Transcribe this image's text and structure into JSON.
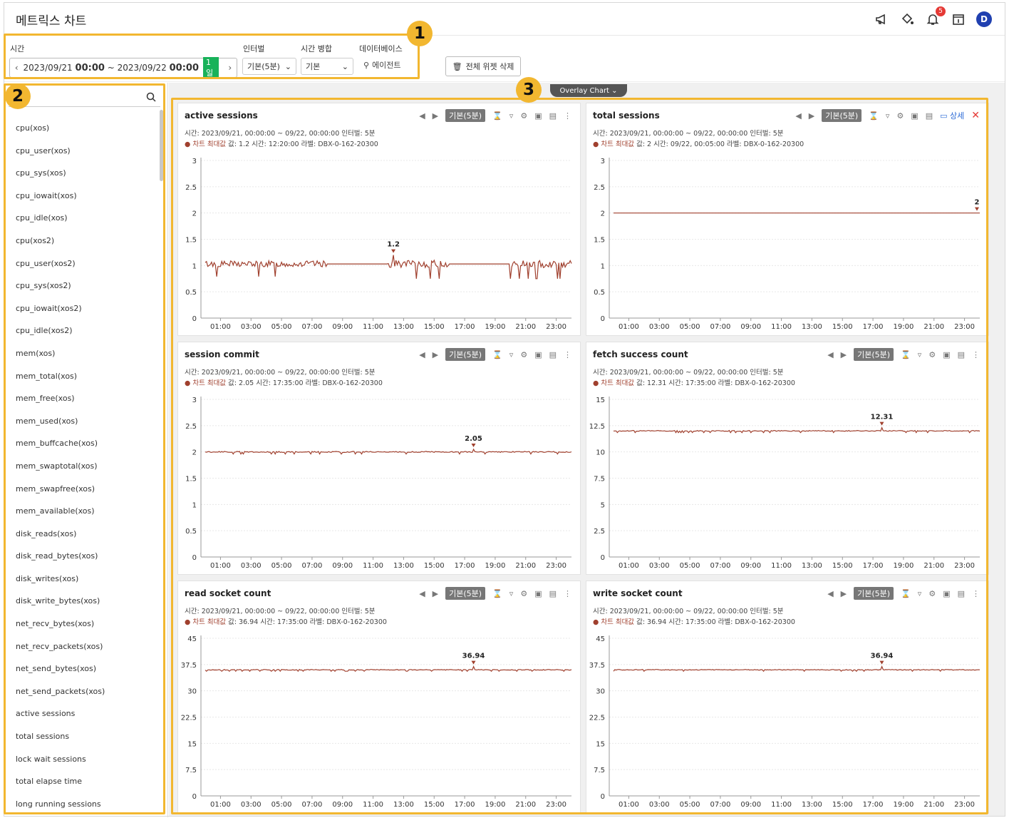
{
  "header": {
    "title": "메트릭스 차트",
    "notif_count": "5",
    "avatar": "D"
  },
  "toolbar": {
    "time_label": "시간",
    "range_start": "2023/09/21",
    "range_start_time": "00:00",
    "range_sep": "~",
    "range_end": "2023/09/22",
    "range_end_time": "00:00",
    "range_badge": "1일",
    "interval_label": "인터벌",
    "interval_value": "기본(5분)",
    "merge_label": "시간 병합",
    "merge_value": "기본",
    "db_label": "데이터베이스",
    "agent_label": "에이전트",
    "delete_all": "전체 위젯 삭제"
  },
  "callouts": [
    "1",
    "2",
    "3"
  ],
  "sidebar": {
    "items": [
      "cpu(xos)",
      "cpu_user(xos)",
      "cpu_sys(xos)",
      "cpu_iowait(xos)",
      "cpu_idle(xos)",
      "cpu(xos2)",
      "cpu_user(xos2)",
      "cpu_sys(xos2)",
      "cpu_iowait(xos2)",
      "cpu_idle(xos2)",
      "mem(xos)",
      "mem_total(xos)",
      "mem_free(xos)",
      "mem_used(xos)",
      "mem_buffcache(xos)",
      "mem_swaptotal(xos)",
      "mem_swapfree(xos)",
      "mem_available(xos)",
      "disk_reads(xos)",
      "disk_read_bytes(xos)",
      "disk_writes(xos)",
      "disk_write_bytes(xos)",
      "net_recv_bytes(xos)",
      "net_recv_packets(xos)",
      "net_send_bytes(xos)",
      "net_send_packets(xos)",
      "active sessions",
      "total sessions",
      "lock wait sessions",
      "total elapse time",
      "long running sessions"
    ]
  },
  "overlay_label": "Overlay Chart",
  "colors": {
    "accent": "#f2b730",
    "series": "#a0402e",
    "badge": "#19b25a"
  },
  "chart_data": [
    {
      "type": "line",
      "title": "active sessions",
      "chip": "기본(5분)",
      "meta": "시간: 2023/09/21, 00:00:00 ~ 09/22, 00:00:00  인터벌: 5분",
      "max_label": "차트 최대값",
      "max_text": "값: 1.2  시간: 12:20:00  라벨: DBX-0-162-20300",
      "yticks": [
        "0",
        "0.5",
        "1",
        "1.5",
        "2",
        "2.5",
        "3"
      ],
      "ylim": [
        0,
        3
      ],
      "xticks": [
        "01:00",
        "03:00",
        "05:00",
        "07:00",
        "09:00",
        "11:00",
        "13:00",
        "15:00",
        "17:00",
        "19:00",
        "21:00",
        "23:00"
      ],
      "base": 1.03,
      "noise": [
        0.06,
        0.06,
        0.0,
        0.07,
        0.0,
        0.07
      ],
      "peak": {
        "x": 12.33,
        "value": 1.2,
        "label": "1.2"
      }
    },
    {
      "type": "line",
      "title": "total sessions",
      "chip": "기본(5분)",
      "meta": "시간: 2023/09/21, 00:00:00 ~ 09/22, 00:00:00  인터벌: 5분",
      "max_label": "차트 최대값",
      "max_text": "값: 2  시간: 09/22, 00:05:00  라벨: DBX-0-162-20300",
      "yticks": [
        "0",
        "0.5",
        "1",
        "1.5",
        "2",
        "2.5",
        "3"
      ],
      "ylim": [
        0,
        3
      ],
      "xticks": [
        "01:00",
        "03:00",
        "05:00",
        "07:00",
        "09:00",
        "11:00",
        "13:00",
        "15:00",
        "17:00",
        "19:00",
        "21:00",
        "23:00"
      ],
      "base": 2,
      "noise": [
        0,
        0,
        0,
        0,
        0,
        0
      ],
      "peak": {
        "x": 24,
        "value": 2,
        "label": "2"
      },
      "detail": "상세"
    },
    {
      "type": "line",
      "title": "session commit",
      "chip": "기본(5분)",
      "meta": "시간: 2023/09/21, 00:00:00 ~ 09/22, 00:00:00  인터벌: 5분",
      "max_label": "차트 최대값",
      "max_text": "값: 2.05  시간: 17:35:00  라벨: DBX-0-162-20300",
      "yticks": [
        "0",
        "0.5",
        "1",
        "1.5",
        "2",
        "2.5",
        "3"
      ],
      "ylim": [
        0,
        3
      ],
      "xticks": [
        "01:00",
        "03:00",
        "05:00",
        "07:00",
        "09:00",
        "11:00",
        "13:00",
        "15:00",
        "17:00",
        "19:00",
        "21:00",
        "23:00"
      ],
      "base": 2,
      "noise": [
        0.01,
        0.01,
        0.01,
        0.01,
        0.01,
        0.01
      ],
      "peak": {
        "x": 17.58,
        "value": 2.05,
        "label": "2.05"
      }
    },
    {
      "type": "line",
      "title": "fetch success count",
      "chip": "기본(5분)",
      "meta": "시간: 2023/09/21, 00:00:00 ~ 09/22, 00:00:00  인터벌: 5분",
      "max_label": "차트 최대값",
      "max_text": "값: 12.31  시간: 17:35:00  라벨: DBX-0-162-20300",
      "yticks": [
        "0",
        "2.5",
        "5",
        "7.5",
        "10",
        "12.5",
        "15"
      ],
      "ylim": [
        0,
        15
      ],
      "xticks": [
        "01:00",
        "03:00",
        "05:00",
        "07:00",
        "09:00",
        "11:00",
        "13:00",
        "15:00",
        "17:00",
        "19:00",
        "21:00",
        "23:00"
      ],
      "base": 12,
      "noise": [
        0.04,
        0.04,
        0.04,
        0.04,
        0.04,
        0.04
      ],
      "peak": {
        "x": 17.58,
        "value": 12.31,
        "label": "12.31"
      }
    },
    {
      "type": "line",
      "title": "read socket count",
      "chip": "기본(5분)",
      "meta": "시간: 2023/09/21, 00:00:00 ~ 09/22, 00:00:00  인터벌: 5분",
      "max_label": "차트 최대값",
      "max_text": "값: 36.94  시간: 17:35:00  라벨: DBX-0-162-20300",
      "yticks": [
        "0",
        "7.5",
        "15",
        "22.5",
        "30",
        "37.5",
        "45"
      ],
      "ylim": [
        0,
        45
      ],
      "xticks": [
        "01:00",
        "03:00",
        "05:00",
        "07:00",
        "09:00",
        "11:00",
        "13:00",
        "15:00",
        "17:00",
        "19:00",
        "21:00",
        "23:00"
      ],
      "base": 36,
      "noise": [
        0.1,
        0.1,
        0.1,
        0.1,
        0.1,
        0.1
      ],
      "peak": {
        "x": 17.58,
        "value": 36.94,
        "label": "36.94"
      }
    },
    {
      "type": "line",
      "title": "write socket count",
      "chip": "기본(5분)",
      "meta": "시간: 2023/09/21, 00:00:00 ~ 09/22, 00:00:00  인터벌: 5분",
      "max_label": "차트 최대값",
      "max_text": "값: 36.94  시간: 17:35:00  라벨: DBX-0-162-20300",
      "yticks": [
        "0",
        "7.5",
        "15",
        "22.5",
        "30",
        "37.5",
        "45"
      ],
      "ylim": [
        0,
        45
      ],
      "xticks": [
        "01:00",
        "03:00",
        "05:00",
        "07:00",
        "09:00",
        "11:00",
        "13:00",
        "15:00",
        "17:00",
        "19:00",
        "21:00",
        "23:00"
      ],
      "base": 36,
      "noise": [
        0.1,
        0.1,
        0.1,
        0.1,
        0.1,
        0.1
      ],
      "peak": {
        "x": 17.58,
        "value": 36.94,
        "label": "36.94"
      }
    }
  ]
}
